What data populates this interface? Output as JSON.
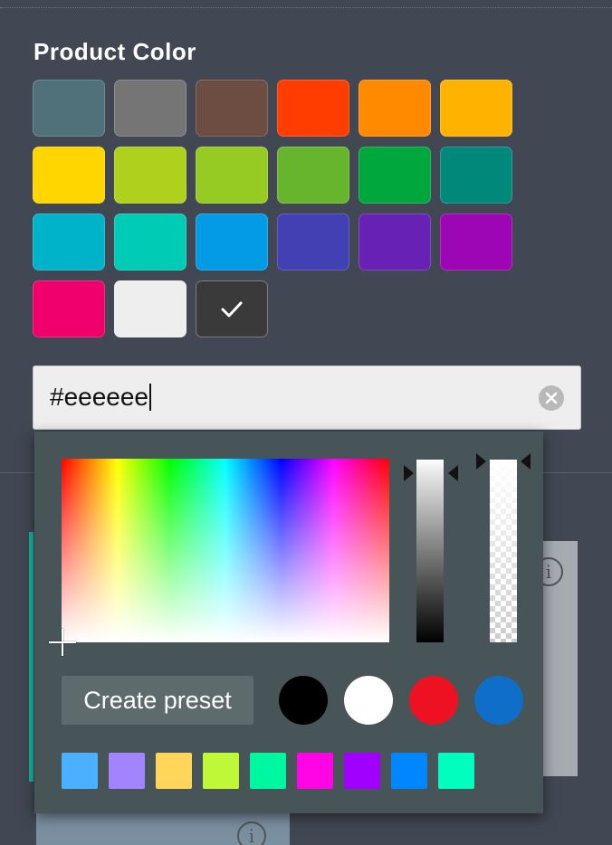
{
  "title": "Product Color",
  "swatches": [
    {
      "color": "#51717a",
      "selected": false
    },
    {
      "color": "#757575",
      "selected": false
    },
    {
      "color": "#6d4c41",
      "selected": false
    },
    {
      "color": "#ff3d00",
      "selected": false
    },
    {
      "color": "#ff8a00",
      "selected": false
    },
    {
      "color": "#ffb300",
      "selected": false
    },
    {
      "color": "#ffd600",
      "selected": false
    },
    {
      "color": "#afd01c",
      "selected": false
    },
    {
      "color": "#96cb24",
      "selected": false
    },
    {
      "color": "#67b52d",
      "selected": false
    },
    {
      "color": "#00a73d",
      "selected": false
    },
    {
      "color": "#00897b",
      "selected": false
    },
    {
      "color": "#00b3c9",
      "selected": false
    },
    {
      "color": "#00cbb5",
      "selected": false
    },
    {
      "color": "#039be5",
      "selected": false
    },
    {
      "color": "#4240b3",
      "selected": false
    },
    {
      "color": "#6721b5",
      "selected": false
    },
    {
      "color": "#9c06b5",
      "selected": false
    },
    {
      "color": "#f0006d",
      "selected": false
    },
    {
      "color": "#eeeeee",
      "selected": false
    },
    {
      "color": "#3a3a3a",
      "selected": true
    }
  ],
  "hex_input": {
    "value": "#eeeeee"
  },
  "picker": {
    "create_preset_label": "Create preset",
    "preset_circles": [
      "#000000",
      "#ffffff",
      "#ee1122",
      "#0e6ec8"
    ],
    "recent_colors": [
      "#4ab0ff",
      "#a384ff",
      "#ffd55a",
      "#bff838",
      "#00f7a2",
      "#ff05e6",
      "#a100ff",
      "#0086ff",
      "#00ffbe"
    ]
  }
}
